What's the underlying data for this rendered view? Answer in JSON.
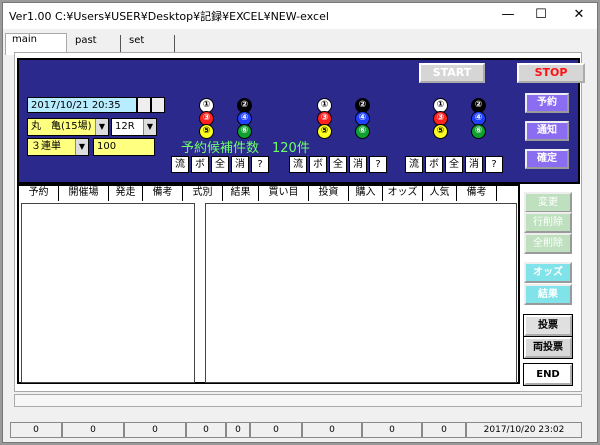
{
  "window": {
    "title": "Ver1.00 C:¥Users¥USER¥Desktop¥記録¥EXCEL¥NEW-excel"
  },
  "tabs": [
    "main",
    "past",
    "set"
  ],
  "top_buttons": {
    "start": "START",
    "stop": "STOP"
  },
  "controls": {
    "datetime": "2017/10/21 20:35",
    "venue": "丸　亀(15場)",
    "race": "12R",
    "bet_type": "３連単",
    "amount": "100"
  },
  "candidate_text": "予約候補件数　120件",
  "numbers": [
    "①",
    "②",
    "③",
    "④",
    "⑤",
    "⑥"
  ],
  "mark_buttons": [
    "流",
    "ボ",
    "全",
    "消",
    "?"
  ],
  "right_buttons": {
    "reserve": "予約",
    "notify": "通知",
    "confirm": "確定"
  },
  "table_headers": [
    "予約",
    "開催場",
    "発走",
    "備考",
    "式別",
    "結果",
    "買い目",
    "投資",
    "購入",
    "オッズ",
    "人気",
    "備考"
  ],
  "side_buttons": {
    "change": "変更",
    "row_delete": "行削除",
    "all_delete": "全削除",
    "odds": "オッズ",
    "result": "結果",
    "ticket": "投票",
    "both_ticket": "両投票",
    "end": "END"
  },
  "status": {
    "cells": [
      "0",
      "0",
      "0",
      "0",
      "0",
      "0",
      "0",
      "0",
      "0"
    ],
    "timestamp": "2017/10/20 23:02"
  },
  "colors": {
    "dark_panel": "#2b2a8c",
    "datetime_bg": "#b8ecff",
    "yellow": "#ffff80",
    "purple": "#8a6df0"
  }
}
